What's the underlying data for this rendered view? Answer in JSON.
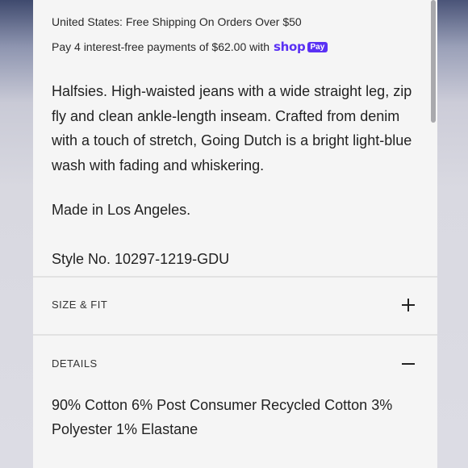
{
  "shipping_notice": "United States: Free Shipping On Orders Over $50",
  "payment": {
    "text": "Pay 4 interest-free payments of $62.00 with",
    "brand": "shop",
    "badge": "Pay"
  },
  "description": {
    "lines": [
      "Halfsies. High-waisted jeans with a wide straight leg, zip",
      "fly and clean ankle-length inseam. Crafted from denim",
      "with a touch of stretch, Going Dutch is a bright light-blue",
      "wash with fading and whiskering."
    ],
    "made_in": "Made in Los Angeles.",
    "style_no": "Style No. 10297-1219-GDU"
  },
  "sections": {
    "size_fit": {
      "label": "SIZE & FIT",
      "icon": "plus-icon",
      "expanded": false
    },
    "details": {
      "label": "DETAILS",
      "icon": "minus-icon",
      "expanded": true,
      "lines": [
        "90% Cotton 6% Post Consumer Recycled Cotton 3%",
        "Polyester 1% Elastane"
      ]
    }
  },
  "colors": {
    "shop_brand": "#5a31f4",
    "panel_background": "#f5f5f5"
  }
}
